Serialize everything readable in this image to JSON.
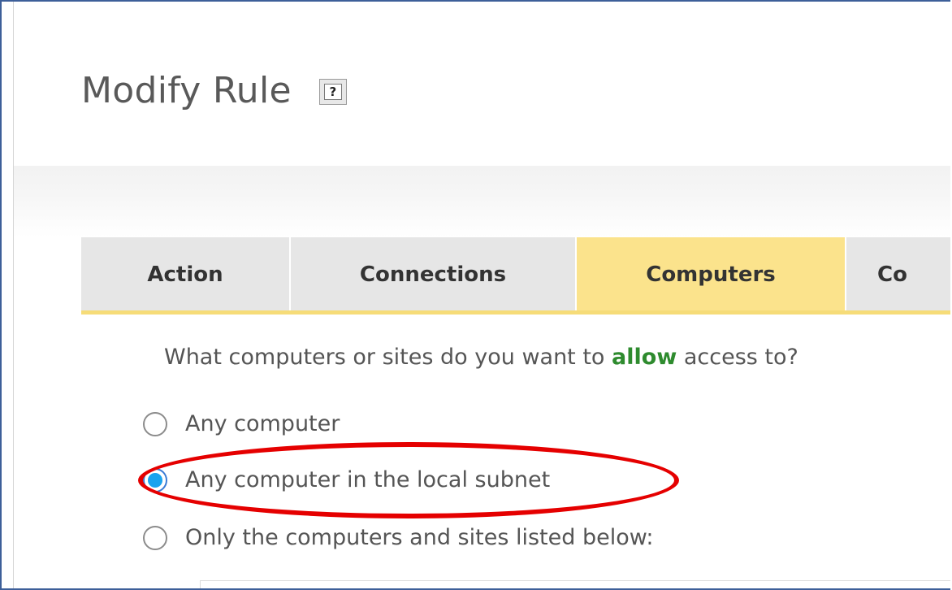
{
  "header": {
    "title": "Modify Rule",
    "help_icon": "help-question-icon",
    "help_glyph": "?"
  },
  "tabs": [
    {
      "label": "Action",
      "active": false
    },
    {
      "label": "Connections",
      "active": false
    },
    {
      "label": "Computers",
      "active": true
    },
    {
      "label": "Co",
      "active": false
    }
  ],
  "computers_panel": {
    "question_prefix": "What computers or sites do you want to ",
    "question_emphasis": "allow",
    "question_suffix": " access to?",
    "options": [
      {
        "label": "Any computer",
        "selected": false
      },
      {
        "label": "Any computer in the local subnet",
        "selected": true
      },
      {
        "label": "Only the computers and sites listed below:",
        "selected": false
      }
    ]
  },
  "colors": {
    "active_tab": "#fbe38c",
    "inactive_tab": "#e6e6e6",
    "allow_text": "#2e8b2e",
    "radio_selected": "#1aa3ee",
    "annotation": "#e50000",
    "frame_border": "#3d5f99"
  }
}
